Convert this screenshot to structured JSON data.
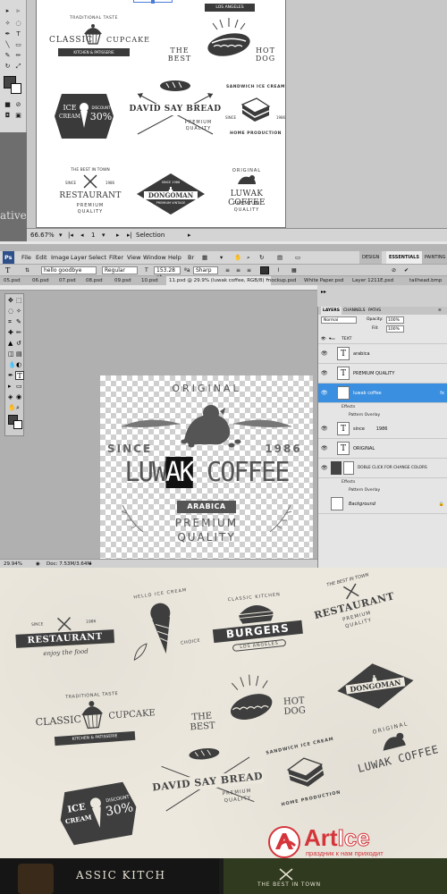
{
  "illustrator": {
    "status": {
      "zoom": "66.67%",
      "page": "1",
      "mode": "Selection"
    },
    "watermark": "ative",
    "badges": {
      "classic_cupcake": {
        "top": "TRADITIONAL TASTE",
        "left": "CLASSIC",
        "right": "CUPCAKE",
        "bottom": "KITCHEN & PATISSERIE"
      },
      "hotdog": {
        "top": "LOS ANGELES",
        "left": "THE BEST",
        "right": "HOT DOG"
      },
      "icecream": {
        "left1": "ICE",
        "left2": "CREAM",
        "right1": "DISCOUNT",
        "right2": "30%"
      },
      "david": {
        "main": "DAVID SAY BREAD",
        "sub1": "PREMIUM",
        "sub2": "QUALITY"
      },
      "sandwich": {
        "arc": "SANDWICH ICE CREAM",
        "since": "SINCE",
        "year": "1986",
        "bottom": "HOME PRODUCTION"
      },
      "restaurant": {
        "top": "THE BEST IN TOWN",
        "since": "SINCE",
        "year": "1986",
        "main": "RESTAURANT",
        "sub1": "PREMIUM",
        "sub2": "QUALITY"
      },
      "dongoman": {
        "since": "SINCE 1986",
        "main": "DONGOMAN",
        "sub": "PREMIUM VINTAGE"
      },
      "luwak": {
        "top": "ORIGINAL",
        "main": "LUWAK COFFEE",
        "sub1": "PREMIUM",
        "sub2": "QUALITY"
      }
    }
  },
  "photoshop": {
    "menu": [
      "Ps",
      "File",
      "Edit",
      "Image",
      "Layer",
      "Select",
      "Filter",
      "View",
      "Window",
      "Help"
    ],
    "workspaces": [
      "DESIGN",
      "ESSENTIALS",
      "PAINTING"
    ],
    "options": {
      "font_sample": "hello goodbye",
      "style": "Regular",
      "size": "153.28 pt",
      "aa": "Sharp"
    },
    "tabs": [
      "05.psd",
      "06.psd",
      "07.psd",
      "08.psd",
      "09.psd",
      "10.psd",
      "11.psd @ 29.9% (luwak coffee, RGB/8) *",
      "mockup.psd",
      "White Paper.psd",
      "Layer 1211E.psd",
      "tailhead.bmp"
    ],
    "canvas": {
      "top": "ORIGINAL",
      "since": "SINCE",
      "year": "1986",
      "main_left": "LUW",
      "main_sel": "AK",
      "main_right": " COFFEE",
      "ribbon": "ARABICA",
      "sub1": "PREMIUM",
      "sub2": "QUALITY"
    },
    "status": {
      "zoom": "29.94%",
      "doc": "Doc: 7.53M/3.64M"
    },
    "layers": {
      "tabs": [
        "LAYERS",
        "CHANNELS",
        "PATHS"
      ],
      "blend": "Normal",
      "opacity_label": "Opacity:",
      "opacity": "100%",
      "fill_label": "Fill:",
      "fill": "100%",
      "group": "TEXT",
      "rows": [
        {
          "name": "arabica"
        },
        {
          "name": "PREMIUM QUALITY"
        },
        {
          "name": "luwak coffee"
        },
        {
          "name": "since        1986"
        },
        {
          "name": "ORIGINAL"
        },
        {
          "name": "DOBLE CLICK FOR CHANGE COLORS"
        },
        {
          "name": "Background"
        }
      ],
      "effects": "Effects",
      "pattern": "Pattern Overlay"
    }
  },
  "paper": {
    "restaurant": {
      "top1": "SINCE",
      "top2": "1986",
      "main": "RESTAURANT",
      "sub": "enjoy the food"
    },
    "icecream": {
      "arc": "HELLO ICE CREAM",
      "choice": "CHOICE"
    },
    "burgers": {
      "arc": "CLASSIC KITCHEN",
      "main": "BURGERS",
      "sub": "LOS ANGELES"
    },
    "restaurant2": {
      "top": "THE BEST IN TOWN",
      "main": "RESTAURANT",
      "sub1": "PREMIUM",
      "sub2": "QUALITY"
    },
    "cupcake": {
      "top": "TRADITIONAL TASTE",
      "left": "CLASSIC",
      "right": "CUPCAKE",
      "bottom": "KITCHEN & PATISSERIE"
    },
    "hotdog": {
      "left": "THE BEST",
      "right": "HOT DOG"
    },
    "dongoman": {
      "main": "DONGOMAN"
    },
    "sandwich": {
      "arc": "SANDWICH ICE CREAM",
      "bottom": "HOME PRODUCTION"
    },
    "luwak": {
      "top": "ORIGINAL",
      "main": "LUWAK COFFEE"
    },
    "david": {
      "main": "DAVID SAY BREAD",
      "sub1": "PREMIUM",
      "sub2": "QUALITY"
    },
    "icecream2": {
      "left1": "ICE",
      "left2": "CREAM",
      "right1": "DISCOUNT",
      "right2": "30%"
    }
  },
  "bottom": {
    "left": "ASSIC KITCH",
    "right": "THE BEST IN TOWN"
  },
  "watermark": {
    "brand_a": "Art",
    "brand_b": "Ice",
    "tagline": "праздник к нам приходит"
  }
}
